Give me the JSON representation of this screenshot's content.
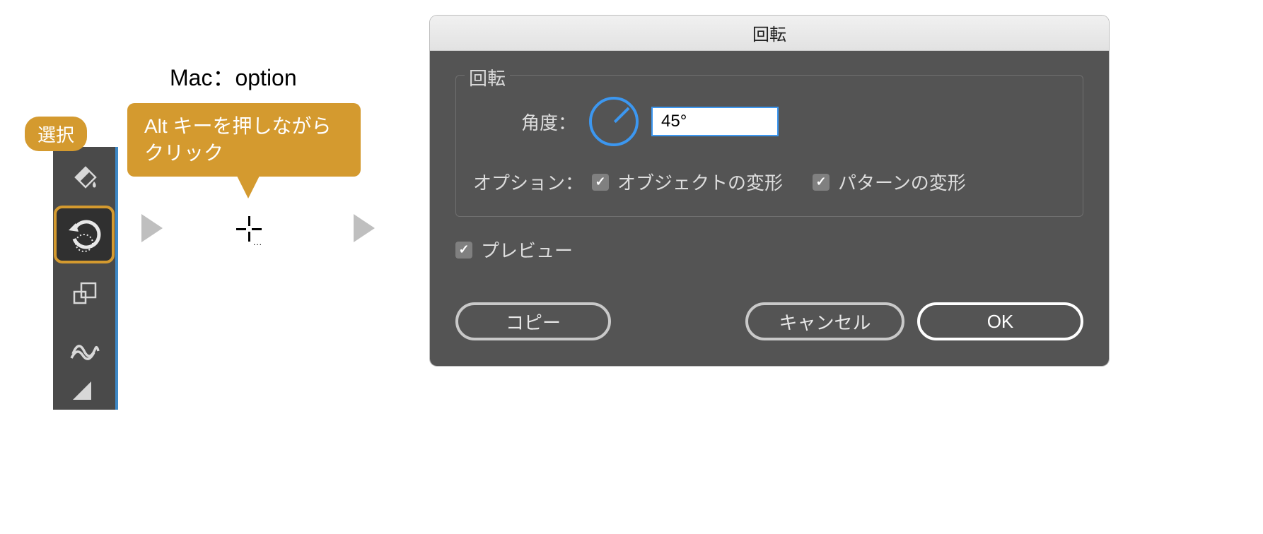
{
  "step1": {
    "select_label": "選択",
    "mac_note": "Mac：option",
    "callout_line1": "Alt キーを押しながら",
    "callout_line2": "クリック"
  },
  "dialog": {
    "title": "回転",
    "group_title": "回転",
    "angle_label": "角度：",
    "angle_value": "45°",
    "options_label": "オプション：",
    "transform_objects_label": "オブジェクトの変形",
    "transform_patterns_label": "パターンの変形",
    "preview_label": "プレビュー",
    "copy_btn": "コピー",
    "cancel_btn": "キャンセル",
    "ok_btn": "OK",
    "checkboxes": {
      "transform_objects": true,
      "transform_patterns": true,
      "preview": true
    }
  }
}
